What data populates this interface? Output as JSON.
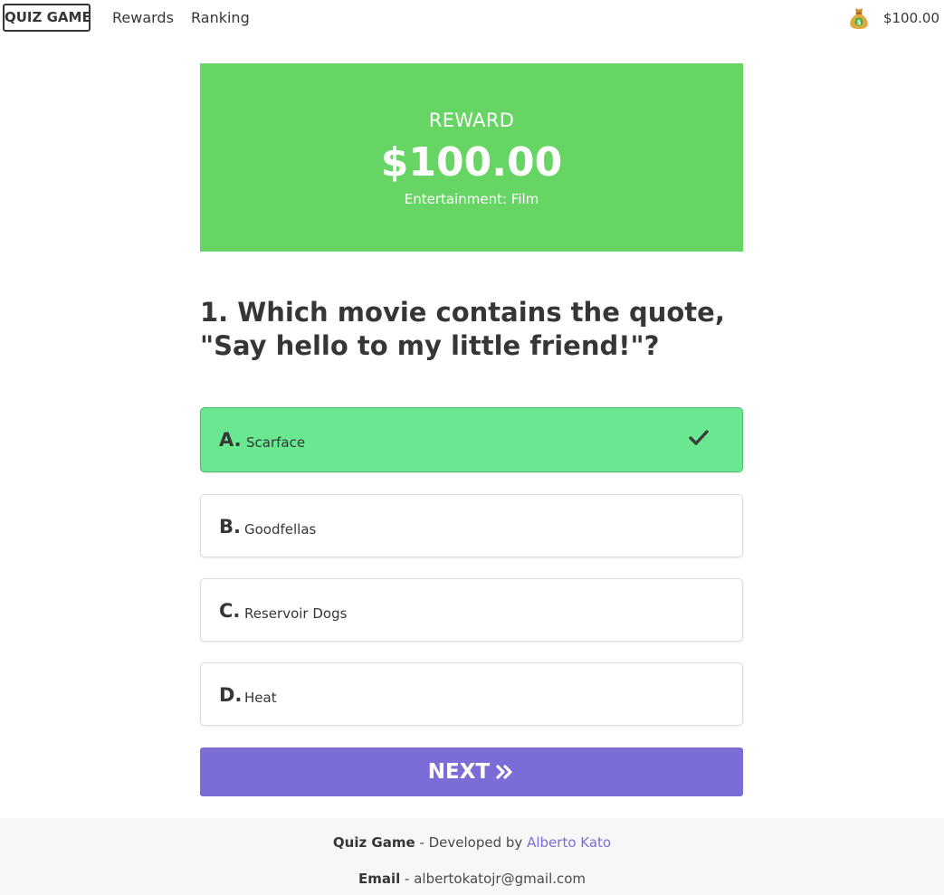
{
  "navbar": {
    "brand": "QUIZ GAME",
    "links": [
      "Rewards",
      "Ranking"
    ],
    "balance_icon": "money-bag-icon",
    "balance": "$100.00"
  },
  "reward": {
    "label": "REWARD",
    "amount": "$100.00",
    "category": "Entertainment: Film",
    "color": "#67d564"
  },
  "question": {
    "text": "1. Which movie contains the quote, \"Say hello to my little friend!\"?"
  },
  "answers": [
    {
      "letter": "A.",
      "text": "Scarface",
      "state": "correct"
    },
    {
      "letter": "B.",
      "text": "Goodfellas",
      "state": "default"
    },
    {
      "letter": "C.",
      "text": "Reservoir Dogs",
      "state": "default"
    },
    {
      "letter": "D.",
      "text": "Heat",
      "state": "default"
    }
  ],
  "correct_color": "#69e890",
  "next_button": {
    "label": "NEXT",
    "icon": "double-chevron-right-icon",
    "color": "#7b6dd6"
  },
  "footer": {
    "app_name": "Quiz Game",
    "developed_by_text": "- Developed by",
    "developer": "Alberto Kato",
    "email_label": "Email",
    "email_separator": "-",
    "email": "albertokatojr@gmail.com"
  }
}
